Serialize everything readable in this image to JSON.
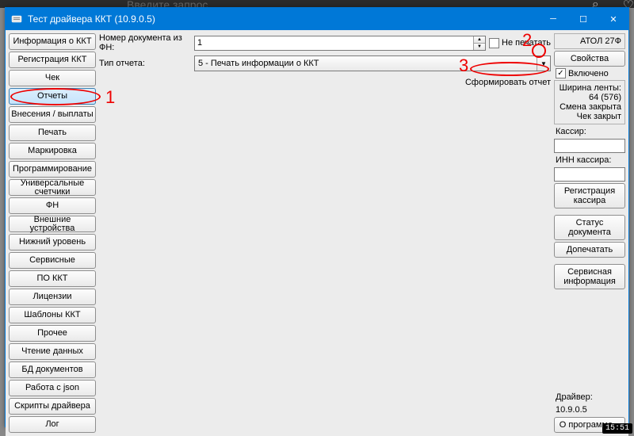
{
  "window": {
    "title": "Тест драйвера ККТ (10.9.0.5)"
  },
  "sidebar": {
    "items": [
      "Информация о ККТ",
      "Регистрация ККТ",
      "Чек",
      "Отчеты",
      "Внесения / выплаты",
      "Печать",
      "Маркировка",
      "Программирование",
      "Универсальные счетчики",
      "ФН",
      "Внешние устройства",
      "Нижний уровень",
      "Сервисные",
      "ПО ККТ",
      "Лицензии",
      "Шаблоны ККТ",
      "Прочее",
      "Чтение данных",
      "БД документов",
      "Работа с json",
      "Скрипты драйвера",
      "Лог"
    ],
    "active_index": 3
  },
  "center": {
    "doc_num_label": "Номер документа из ФН:",
    "doc_num_value": "1",
    "no_print_label": "Не печатать",
    "no_print_checked": false,
    "report_type_label": "Тип отчета:",
    "report_type_value": "5 - Печать информации о ККТ",
    "form_report_label": "Сформировать отчет"
  },
  "right": {
    "device": "АТОЛ 27Ф",
    "properties_btn": "Свойства",
    "enabled_label": "Включено",
    "enabled_checked": true,
    "tape_width_label": "Ширина ленты:",
    "tape_width_value": "64 (576)",
    "shift_status": "Смена закрыта",
    "check_status": "Чек закрыт",
    "cashier_label": "Кассир:",
    "cashier_value": "",
    "cashier_inn_label": "ИНН кассира:",
    "cashier_inn_value": "",
    "register_cashier_btn": "Регистрация кассира",
    "doc_status_btn": "Статус документа",
    "reprint_btn": "Допечатать",
    "service_info_btn": "Сервисная информация",
    "driver_label": "Драйвер:",
    "driver_version": "10.9.0.5",
    "about_btn": "О программе..."
  },
  "annotations": {
    "a1": "1",
    "a2": "2",
    "a3": "3"
  },
  "background": {
    "search_placeholder": "Введите запрос",
    "clock": "15:51"
  }
}
